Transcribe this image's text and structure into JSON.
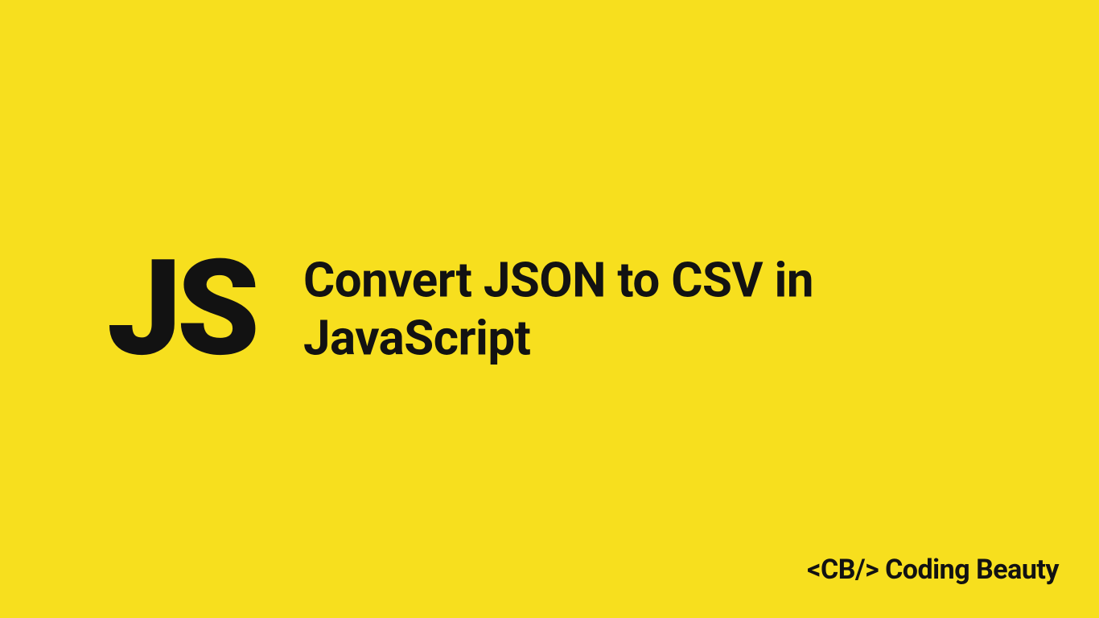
{
  "badge": "JS",
  "title": "Convert JSON to CSV in JavaScript",
  "brand": "<CB/> Coding Beauty",
  "colors": {
    "background": "#F7DF1E",
    "text": "#121212"
  }
}
